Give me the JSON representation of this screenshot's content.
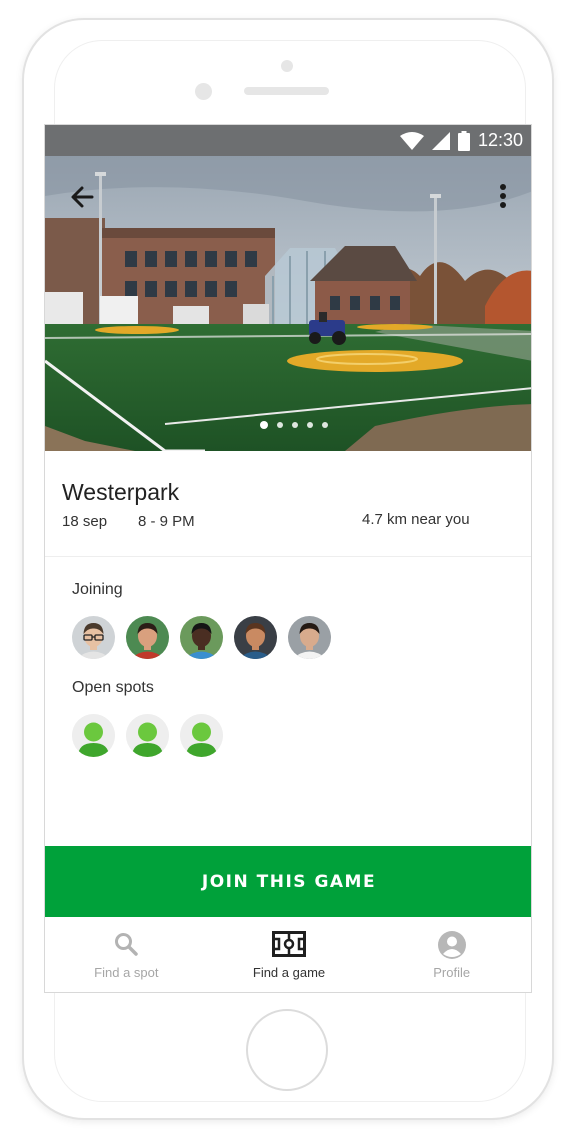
{
  "status_bar": {
    "time": "12:30"
  },
  "game": {
    "venue": "Westerpark",
    "date": "18 sep",
    "time": "8 - 9 PM",
    "distance": "4.7 km near you"
  },
  "gallery": {
    "photo_count": 5,
    "active_index": 0
  },
  "joining": {
    "label": "Joining",
    "players": [
      {
        "shirt": "#e4e4e4",
        "hair": "#4a3a2c",
        "skin": "#e7c1a3",
        "bg": "#cfd3d6",
        "glasses": true
      },
      {
        "shirt": "#c0392b",
        "hair": "#2b1e17",
        "skin": "#d9a07e",
        "bg": "#4d8a52",
        "glasses": false
      },
      {
        "shirt": "#3a8fd0",
        "hair": "#151515",
        "skin": "#4a2e22",
        "bg": "#6b9a5c",
        "glasses": false
      },
      {
        "shirt": "#2a5d8a",
        "hair": "#5a3520",
        "skin": "#c98a62",
        "bg": "#3a3f46",
        "glasses": false
      },
      {
        "shirt": "#f3f3f3",
        "hair": "#241a14",
        "skin": "#d8ab8d",
        "bg": "#9aa0a5",
        "glasses": false
      }
    ]
  },
  "open_spots": {
    "label": "Open spots",
    "count": 3
  },
  "join_button": {
    "label": "JOIN THIS GAME"
  },
  "nav": {
    "items": [
      {
        "label": "Find a spot",
        "icon": "search-icon",
        "active": false
      },
      {
        "label": "Find a game",
        "icon": "field-icon",
        "active": true
      },
      {
        "label": "Profile",
        "icon": "profile-icon",
        "active": false
      }
    ]
  },
  "colors": {
    "accent": "#00a13a",
    "avatar_green": "#6bc83e",
    "avatar_green_dark": "#3fa62c",
    "status_bar": "#6d6f71"
  }
}
